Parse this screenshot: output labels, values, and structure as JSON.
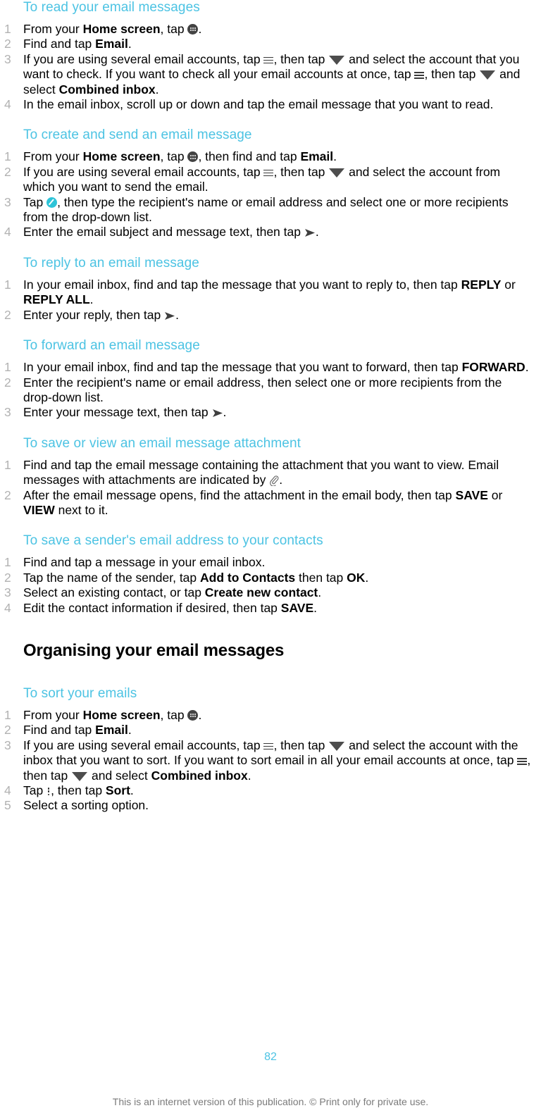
{
  "colors": {
    "heading_accent": "#4cc3e3",
    "body_text": "#000000",
    "step_number": "#b2b2b2",
    "footer_note": "#7a7a7a",
    "compose_icon": "#2ec4d8",
    "apps_icon": "#434343"
  },
  "sections": [
    {
      "id": "read-email",
      "heading": "To read your email messages",
      "steps": [
        "From your <b>Home screen</b>, tap <icon name=\"apps-drawer-icon\"></icon>.",
        "Find and tap <b>Email</b>.",
        "If you are using several email accounts, tap <icon name=\"menu-icon\"></icon>, then tap <icon name=\"caret-down-icon\"></icon> and select the account that you want to check. If you want to check all your email accounts at once, tap <icon name=\"menu-icon\"></icon>, then tap <icon name=\"caret-down-icon\"></icon> and select <b>Combined inbox</b>.",
        "In the email inbox, scroll up or down and tap the email message that you want to read."
      ]
    },
    {
      "id": "create-send-email",
      "heading": "To create and send an email message",
      "steps": [
        "From your <b>Home screen</b>, tap <icon name=\"apps-drawer-icon\"></icon>, then find and tap <b>Email</b>.",
        "If you are using several email accounts, tap <icon name=\"menu-icon\"></icon>, then tap <icon name=\"caret-down-icon\"></icon> and select the account from which you want to send the email.",
        "Tap <icon name=\"compose-icon\"></icon>, then type the recipient's name or email address and select one or more recipients from the drop-down list.",
        "Enter the email subject and message text, then tap <icon name=\"send-icon\"></icon>."
      ]
    },
    {
      "id": "reply-email",
      "heading": "To reply to an email message",
      "steps": [
        "In your email inbox, find and tap the message that you want to reply to, then tap <b>REPLY</b> or <b>REPLY ALL</b>.",
        "Enter your reply, then tap <icon name=\"send-icon\"></icon>."
      ]
    },
    {
      "id": "forward-email",
      "heading": "To forward an email message",
      "steps": [
        "In your email inbox, find and tap the message that you want to forward, then tap <b>FORWARD</b>.",
        "Enter the recipient's name or email address, then select one or more recipients from the drop-down list.",
        "Enter your message text, then tap <icon name=\"send-icon\"></icon>."
      ]
    },
    {
      "id": "save-view-attachment",
      "heading": "To save or view an email message attachment",
      "steps": [
        "Find and tap the email message containing the attachment that you want to view. Email messages with attachments are indicated by <icon name=\"paperclip-icon\"></icon>.",
        "After the email message opens, find the attachment in the email body, then tap <b>SAVE</b> or <b>VIEW</b> next to it."
      ]
    },
    {
      "id": "save-sender-address",
      "heading": "To save a sender's email address to your contacts",
      "steps": [
        "Find and tap a message in your email inbox.",
        "Tap the name of the sender, tap <b>Add to Contacts</b> then tap <b>OK</b>.",
        "Select an existing contact, or tap <b>Create new contact</b>.",
        "Edit the contact information if desired, then tap <b>SAVE</b>."
      ]
    }
  ],
  "main_heading": "Organising your email messages",
  "sections_after": [
    {
      "id": "sort-emails",
      "heading": "To sort your emails",
      "steps": [
        "From your <b>Home screen</b>, tap <icon name=\"apps-drawer-icon\"></icon>.",
        "Find and tap <b>Email</b>.",
        "If you are using several email accounts, tap <icon name=\"menu-icon\"></icon>, then tap <icon name=\"caret-down-icon\"></icon> and select the account with the inbox that you want to sort. If you want to sort email in all your email accounts at once, tap <icon name=\"menu-icon\"></icon>, then tap <icon name=\"caret-down-icon\"></icon> and select <b>Combined inbox</b>.",
        "Tap <icon name=\"overflow-menu-icon\"></icon>, then tap <b>Sort</b>.",
        "Select a sorting option."
      ]
    }
  ],
  "footer": {
    "page_number": "82",
    "note": "This is an internet version of this publication. © Print only for private use."
  }
}
